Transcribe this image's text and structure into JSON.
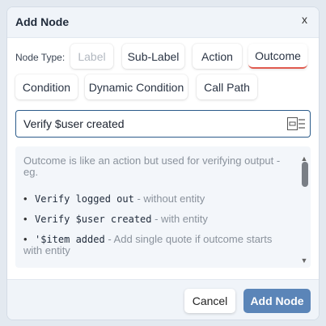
{
  "dialog": {
    "title": "Add Node",
    "close_label": "x"
  },
  "node_type": {
    "label": "Node Type:",
    "options": [
      "Label",
      "Sub-Label",
      "Action",
      "Outcome",
      "Condition",
      "Dynamic Condition",
      "Call Path"
    ],
    "disabled": "Label",
    "selected": "Outcome"
  },
  "input": {
    "value": "Verify $user created",
    "icon": "text-format-icon"
  },
  "help": {
    "intro": "Outcome is like an action but used for verifying output -eg.",
    "items": [
      {
        "code": "Verify logged out",
        "note": " - without entity"
      },
      {
        "code": "Verify $user created",
        "note": " - with entity"
      },
      {
        "code": "'$item added",
        "note": " - Add single quote if outcome starts with entity"
      }
    ]
  },
  "footer": {
    "cancel_label": "Cancel",
    "add_label": "Add Node"
  },
  "colors": {
    "accent": "#5b85b8",
    "selected_underline": "#e05a4f",
    "input_border": "#2b5b8a"
  }
}
